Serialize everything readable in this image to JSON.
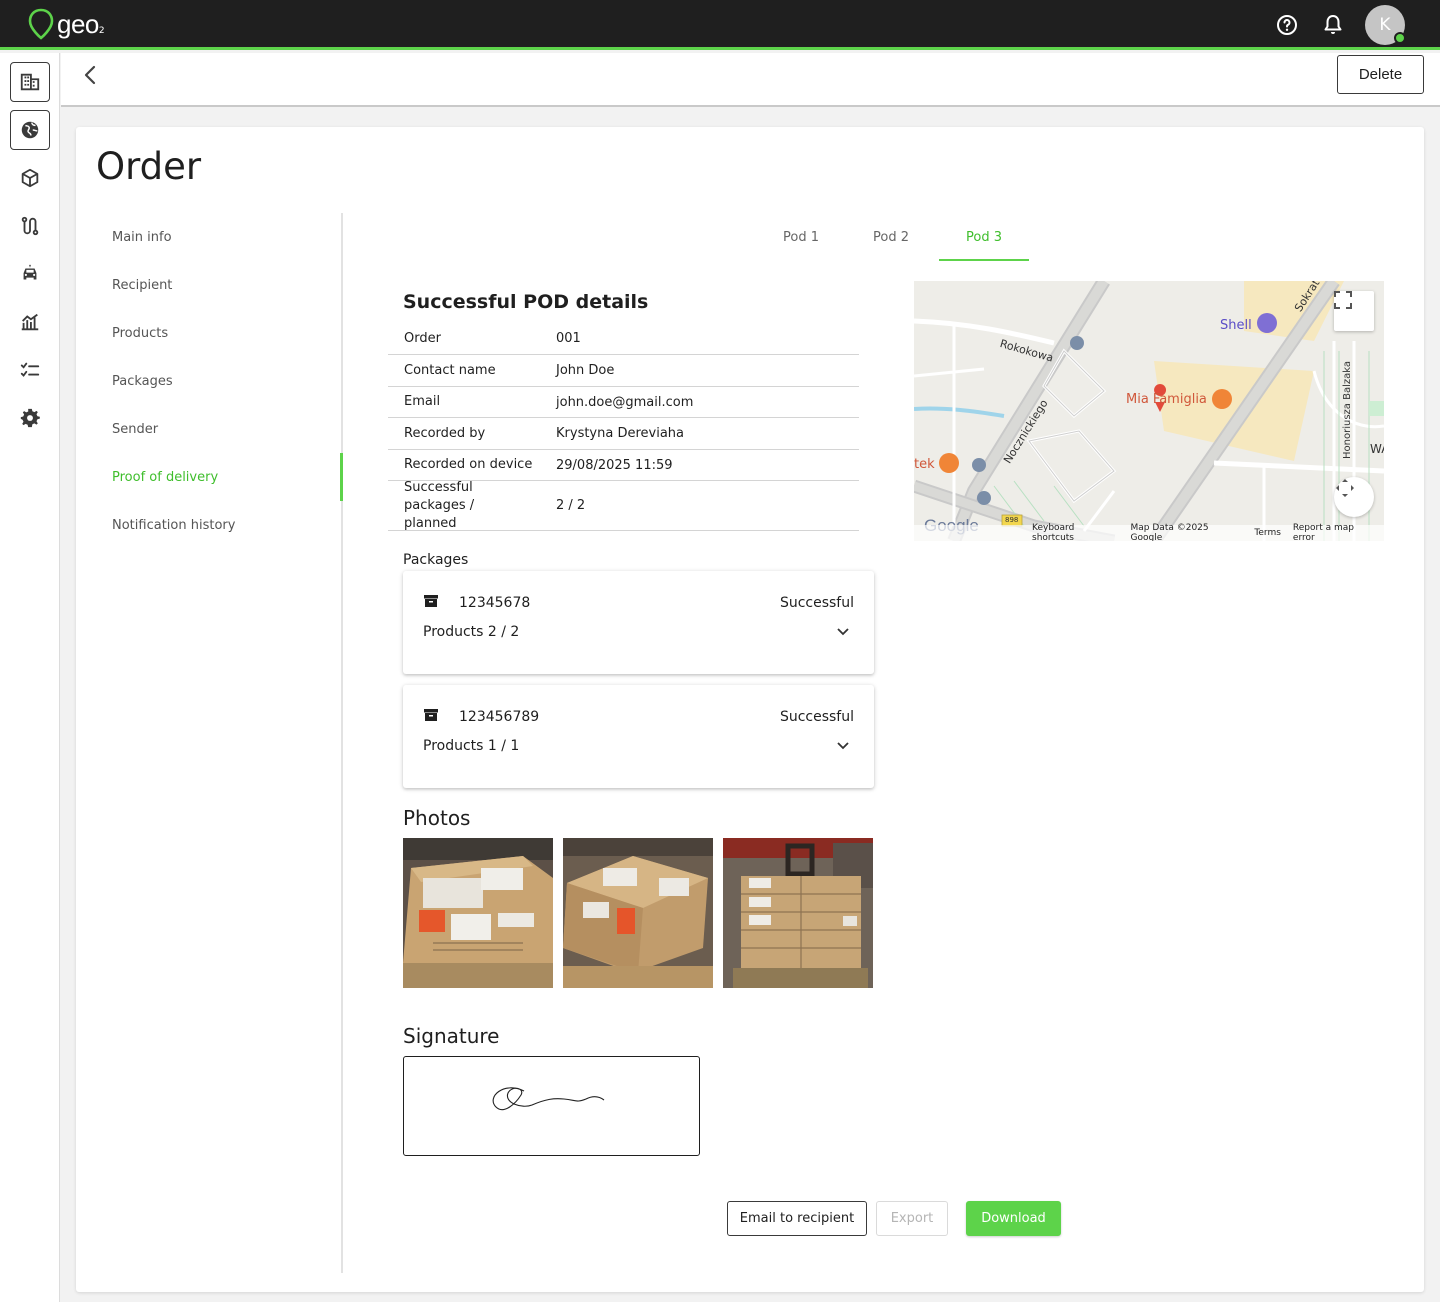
{
  "app": {
    "logo_text": "geo",
    "logo_sub": "2"
  },
  "topbar": {
    "avatar_initial": "K"
  },
  "header": {
    "delete_label": "Delete"
  },
  "page": {
    "title": "Order"
  },
  "sidenav": {
    "items": [
      {
        "label": "Main info"
      },
      {
        "label": "Recipient"
      },
      {
        "label": "Products"
      },
      {
        "label": "Packages"
      },
      {
        "label": "Sender"
      },
      {
        "label": "Proof of delivery",
        "active": true
      },
      {
        "label": "Notification history"
      }
    ]
  },
  "tabs": [
    {
      "label": "Pod 1"
    },
    {
      "label": "Pod 2"
    },
    {
      "label": "Pod 3",
      "active": true
    }
  ],
  "pod": {
    "title": "Successful POD details",
    "rows": [
      {
        "key": "Order",
        "value": "001"
      },
      {
        "key": "Contact name",
        "value": "John Doe"
      },
      {
        "key": "Email",
        "value": "john.doe@gmail.com"
      },
      {
        "key": "Recorded by",
        "value": "Krystyna Dereviaha"
      },
      {
        "key": "Recorded on device",
        "value": "29/08/2025 11:59"
      },
      {
        "key": "Successful packages / planned",
        "value": "2 / 2"
      }
    ]
  },
  "packages": {
    "label": "Packages",
    "items": [
      {
        "number": "12345678",
        "status": "Successful",
        "products": "Products 2 / 2"
      },
      {
        "number": "123456789",
        "status": "Successful",
        "products": "Products 1 / 1"
      }
    ]
  },
  "photos": {
    "title": "Photos"
  },
  "signature": {
    "title": "Signature"
  },
  "map": {
    "labels": {
      "shell": "Shell",
      "sokratesa": "Sokratesa",
      "rokokowa": "Rokokowa",
      "nocznickiego": "Nocznickiego",
      "mia": "Mia Famiglia",
      "balzaka": "Honoriusza Balzaka",
      "wa": "WA",
      "tek": "tek",
      "road_number": "898",
      "google": "Google"
    },
    "footer": {
      "keyboard": "Keyboard shortcuts",
      "data": "Map Data ©2025 Google",
      "terms": "Terms",
      "report": "Report a map error"
    }
  },
  "actions": {
    "email_label": "Email to recipient",
    "export_label": "Export",
    "download_label": "Download"
  },
  "colors": {
    "accent": "#5dd34a",
    "accent_text": "#3fbe2c",
    "topbar": "#1f1f1f"
  }
}
